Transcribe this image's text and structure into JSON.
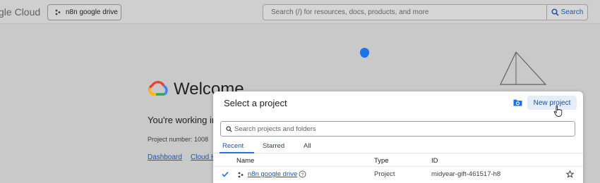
{
  "topbar": {
    "logo_partial": "gle",
    "logo_cloud": "Cloud",
    "project_selector_label": "n8n google drive",
    "search_placeholder": "Search (/) for resources, docs, products, and more",
    "search_button_label": "Search"
  },
  "background": {
    "welcome_title": "Welcome",
    "working_in": "You're working in",
    "project_number": "Project number:  1008",
    "links": [
      "Dashboard",
      "Cloud H"
    ]
  },
  "dialog": {
    "title": "Select a project",
    "new_project_label": "New project",
    "search_placeholder": "Search projects and folders",
    "tabs": [
      {
        "label": "Recent",
        "active": true
      },
      {
        "label": "Starred",
        "active": false
      },
      {
        "label": "All",
        "active": false
      }
    ],
    "columns": {
      "name": "Name",
      "type": "Type",
      "id": "ID"
    },
    "rows": [
      {
        "name": "n8n google drive",
        "type": "Project",
        "id": "midyear-gift-461517-h8",
        "selected": true
      }
    ]
  },
  "colors": {
    "accent": "#1a73e8",
    "link": "#1a55b5"
  },
  "icons": [
    "search-icon",
    "project-dots-icon",
    "folder-add-icon",
    "checkmark-icon",
    "help-circle-icon",
    "star-icon",
    "cursor-hand-icon",
    "google-cloud-logo-icon"
  ]
}
